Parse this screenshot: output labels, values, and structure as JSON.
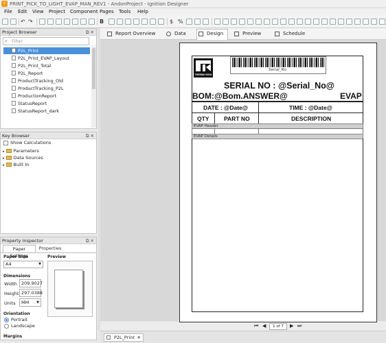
{
  "window": {
    "title": "PRINT_PICK_TO_LIGHT_EVAP_MAN_REV1 - AndonProject - Ignition Designer"
  },
  "menu": [
    "File",
    "Edit",
    "View",
    "Project",
    "Component",
    "Pages",
    "Tools",
    "Help"
  ],
  "project_browser": {
    "title": "Project Browser",
    "filter_placeholder": "Filter",
    "items": [
      {
        "label": "P2L_Print",
        "selected": true
      },
      {
        "label": "P2L_Print_EVAP_Layout"
      },
      {
        "label": "P2L_Print_Total"
      },
      {
        "label": "P2L_Report"
      },
      {
        "label": "ProductTracking_Old"
      },
      {
        "label": "ProductTracking_P2L"
      },
      {
        "label": "ProductionReport"
      },
      {
        "label": "StatusReport"
      },
      {
        "label": "StatusReport_dark"
      }
    ]
  },
  "key_browser": {
    "title": "Key Browser",
    "show_calc": "Show Calculations",
    "items": [
      "Parameters",
      "Data Sources",
      "Built In"
    ]
  },
  "property_inspector": {
    "title": "Property Inspector",
    "tabs": [
      "Paper Settings",
      "Properties"
    ],
    "paper_size_label": "Paper Size",
    "paper_size_value": "A4",
    "preview_label": "Preview",
    "dimensions_label": "Dimensions",
    "width_label": "Width",
    "width_value": "209.9027",
    "height_label": "Height",
    "height_value": "297.0388",
    "units_label": "Units",
    "units_value": "MM",
    "orientation_label": "Orientation",
    "portrait": "Portrait",
    "landscape": "Landscape",
    "margins_label": "Margins"
  },
  "editor_tabs": [
    "Report Overview",
    "Data",
    "Design",
    "Preview",
    "Schedule"
  ],
  "report": {
    "logo_text": "THERMO KING",
    "serial_small": "Serial_No",
    "serial_line": "SERIAL NO  : @Serial_No@",
    "bom_line": "BOM:@Bom.ANSWER@",
    "evap": "EVAP",
    "date": "DATE : @Date@",
    "time": "TIME : @Date@",
    "qty": "QTY",
    "part_no": "PART NO",
    "description": "DESCRIPTION",
    "evap_header": "EVAP Header",
    "evap_details": "EVAP Details"
  },
  "pager": {
    "page": "1 of 7"
  },
  "bottom_tab": "P2L_Print"
}
